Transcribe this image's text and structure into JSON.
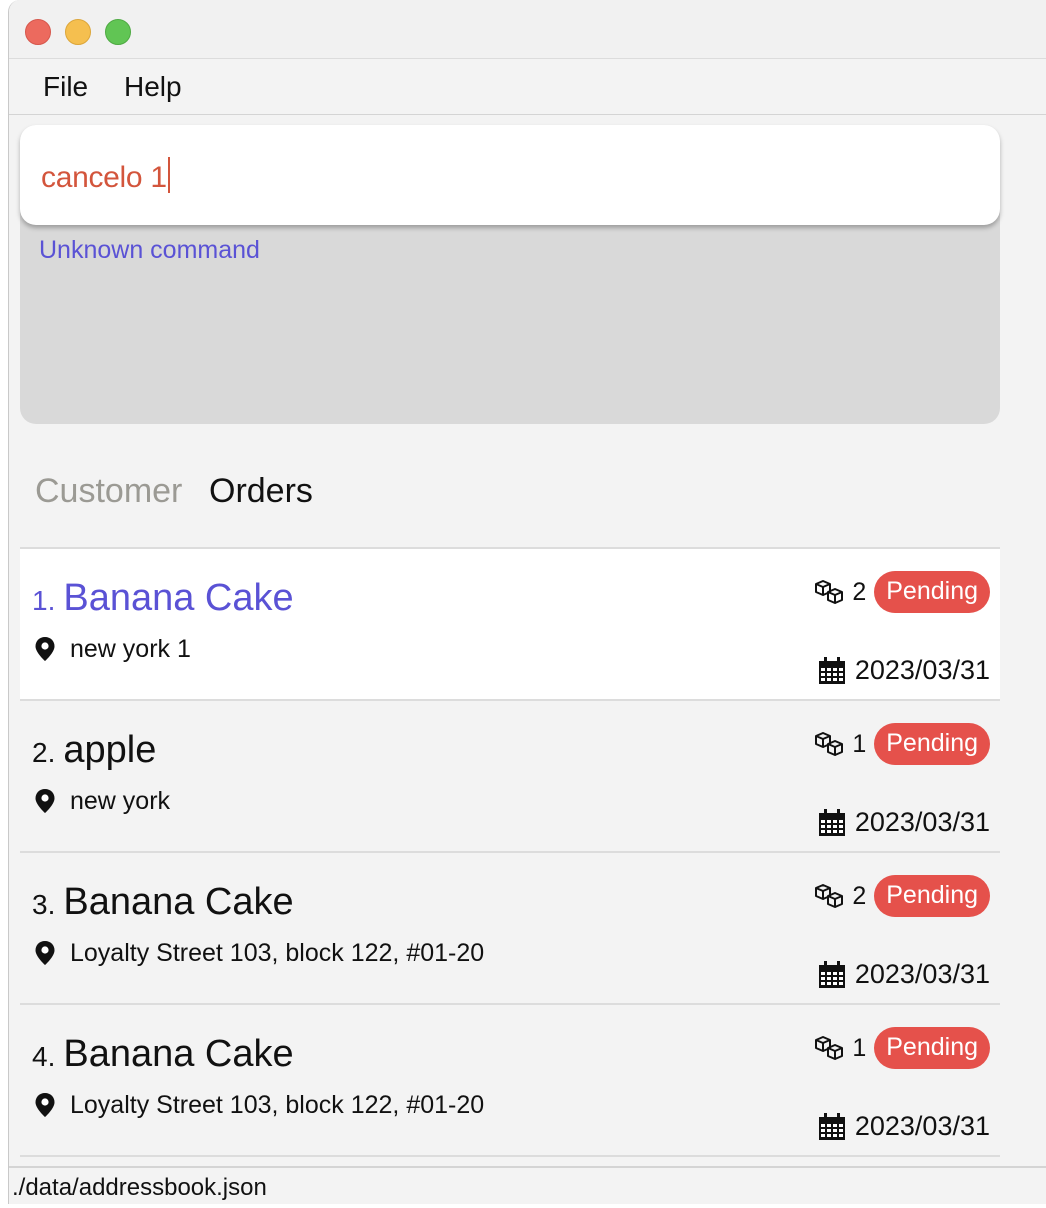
{
  "menubar": {
    "items": [
      {
        "label": "File"
      },
      {
        "label": "Help"
      }
    ]
  },
  "command": {
    "input_value": "cancelo 1",
    "result": "Unknown command"
  },
  "tabs": [
    {
      "label": "Customer",
      "active": false
    },
    {
      "label": "Orders",
      "active": true
    }
  ],
  "orders": [
    {
      "index": "1.",
      "name": "Banana Cake",
      "address": "new york 1",
      "quantity": "2",
      "status": "Pending",
      "date": "2023/03/31",
      "selected": true
    },
    {
      "index": "2.",
      "name": "apple",
      "address": "new york",
      "quantity": "1",
      "status": "Pending",
      "date": "2023/03/31",
      "selected": false
    },
    {
      "index": "3.",
      "name": "Banana Cake",
      "address": "Loyalty Street 103, block 122, #01-20",
      "quantity": "2",
      "status": "Pending",
      "date": "2023/03/31",
      "selected": false
    },
    {
      "index": "4.",
      "name": "Banana Cake",
      "address": "Loyalty Street 103, block 122, #01-20",
      "quantity": "1",
      "status": "Pending",
      "date": "2023/03/31",
      "selected": false
    }
  ],
  "status_bar": {
    "path": "./data/addressbook.json"
  },
  "colors": {
    "accent": "#5a52d5",
    "command_text": "#d3553c",
    "pending_badge": "#e5514b",
    "inactive_tab": "#9b9a94"
  },
  "icons": {
    "close": "close-window-icon",
    "minimize": "minimize-window-icon",
    "maximize": "maximize-window-icon",
    "address": "location-pin-icon",
    "quantity": "boxes-icon",
    "date": "calendar-icon"
  }
}
